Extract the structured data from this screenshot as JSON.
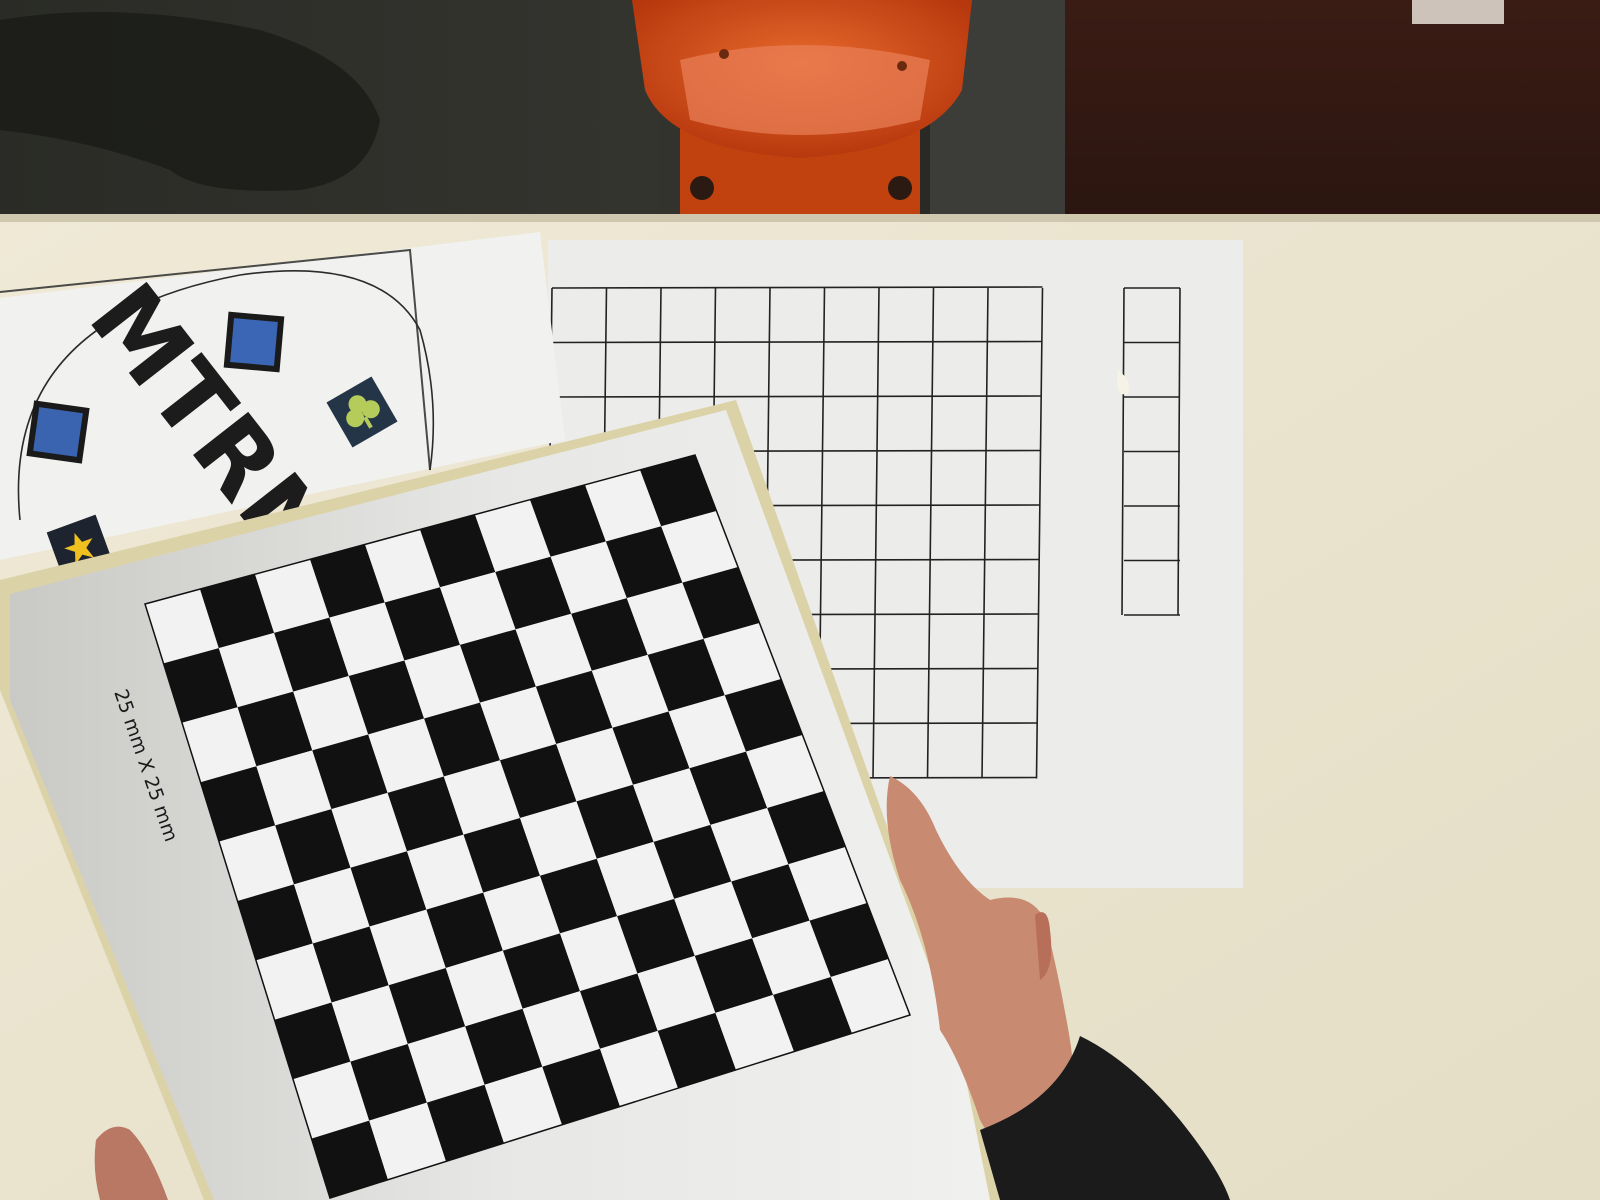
{
  "scene": {
    "description_free": true,
    "colors": {
      "floor": "#2b2c27",
      "robot_orange": "#d24a16",
      "table": "#ebe6d2",
      "paper": "#ecebea",
      "board_frame": "#e2d9b4",
      "square_dark": "#111111",
      "square_light": "#f2f2f2",
      "skin": "#c9806a",
      "sleeve": "#1a1a1a"
    }
  },
  "logo_sheet": {
    "text": "MTRN4",
    "markers": [
      "blue-square-marker",
      "blue-square-marker",
      "clover-marker",
      "star-marker"
    ]
  },
  "grid_sheet": {
    "main_cols": 9,
    "main_rows": 9,
    "side_cols": 1,
    "side_rows": 6
  },
  "calibration_board": {
    "rows": 10,
    "cols": 10,
    "label": "25 mm X 25 mm"
  }
}
